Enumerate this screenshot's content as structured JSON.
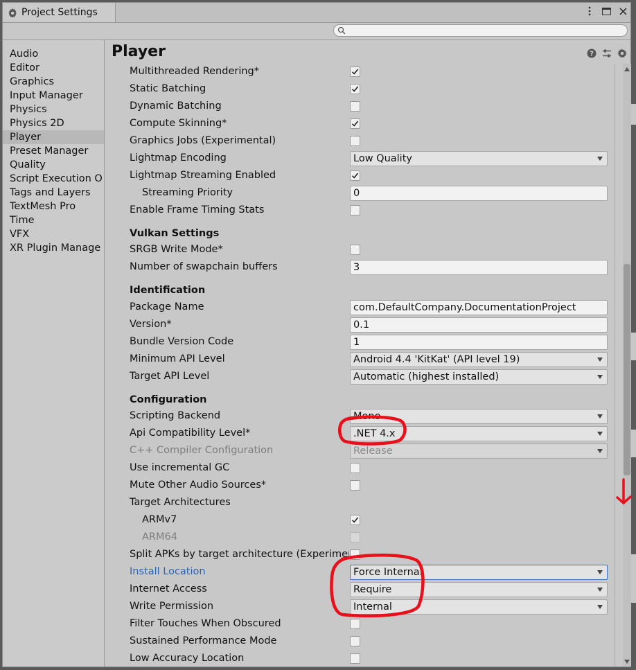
{
  "window": {
    "tab_title": "Project Settings",
    "search_placeholder": ""
  },
  "sidebar": {
    "items": [
      {
        "label": "Audio"
      },
      {
        "label": "Editor"
      },
      {
        "label": "Graphics"
      },
      {
        "label": "Input Manager"
      },
      {
        "label": "Physics"
      },
      {
        "label": "Physics 2D"
      },
      {
        "label": "Player",
        "active": true
      },
      {
        "label": "Preset Manager"
      },
      {
        "label": "Quality"
      },
      {
        "label": "Script Execution O"
      },
      {
        "label": "Tags and Layers"
      },
      {
        "label": "TextMesh Pro"
      },
      {
        "label": "Time"
      },
      {
        "label": "VFX"
      },
      {
        "label": "XR Plugin Manage"
      }
    ]
  },
  "main": {
    "title": "Player",
    "help_icon": "help-icon",
    "preset_icon": "sliders-icon",
    "settings_icon": "gear-icon"
  },
  "settings": {
    "multithreaded_rendering": {
      "label": "Multithreaded Rendering*",
      "checked": true
    },
    "static_batching": {
      "label": "Static Batching",
      "checked": true
    },
    "dynamic_batching": {
      "label": "Dynamic Batching",
      "checked": false
    },
    "compute_skinning": {
      "label": "Compute Skinning*",
      "checked": true
    },
    "graphics_jobs": {
      "label": "Graphics Jobs (Experimental)",
      "checked": false
    },
    "lightmap_encoding": {
      "label": "Lightmap Encoding",
      "value": "Low Quality"
    },
    "lightmap_streaming": {
      "label": "Lightmap Streaming Enabled",
      "checked": true
    },
    "streaming_priority": {
      "label": "Streaming Priority",
      "value": "0"
    },
    "frame_timing": {
      "label": "Enable Frame Timing Stats",
      "checked": false
    },
    "vulkan_header": "Vulkan Settings",
    "srgb_write": {
      "label": "SRGB Write Mode*",
      "checked": false
    },
    "swapchain_buffers": {
      "label": "Number of swapchain buffers",
      "value": "3"
    },
    "identification_header": "Identification",
    "package_name": {
      "label": "Package Name",
      "value": "com.DefaultCompany.DocumentationProject"
    },
    "version": {
      "label": "Version*",
      "value": "0.1"
    },
    "bundle_version_code": {
      "label": "Bundle Version Code",
      "value": "1"
    },
    "min_api": {
      "label": "Minimum API Level",
      "value": "Android 4.4 'KitKat' (API level 19)"
    },
    "target_api": {
      "label": "Target API Level",
      "value": "Automatic (highest installed)"
    },
    "configuration_header": "Configuration",
    "scripting_backend": {
      "label": "Scripting Backend",
      "value": "Mono"
    },
    "api_compat": {
      "label": "Api Compatibility Level*",
      "value": ".NET 4.x"
    },
    "cpp_config": {
      "label": "C++ Compiler Configuration",
      "value": "Release"
    },
    "incremental_gc": {
      "label": "Use incremental GC",
      "checked": false
    },
    "mute_audio": {
      "label": "Mute Other Audio Sources*",
      "checked": false
    },
    "target_arch": {
      "label": "Target Architectures"
    },
    "armv7": {
      "label": "ARMv7",
      "checked": true
    },
    "arm64": {
      "label": "ARM64",
      "checked": false
    },
    "split_apks": {
      "label": "Split APKs by target architecture (Experimental)",
      "checked": false
    },
    "install_location": {
      "label": "Install Location",
      "value": "Force Internal"
    },
    "internet_access": {
      "label": "Internet Access",
      "value": "Require"
    },
    "write_permission": {
      "label": "Write Permission",
      "value": "Internal"
    },
    "filter_touches": {
      "label": "Filter Touches When Obscured",
      "checked": false
    },
    "sustained_perf": {
      "label": "Sustained Performance Mode",
      "checked": false
    },
    "low_accuracy": {
      "label": "Low Accuracy Location",
      "checked": false
    }
  },
  "colors": {
    "annotation": "#e8101a",
    "link_blue": "#2a64b0",
    "focus_blue": "#3a72c4"
  }
}
